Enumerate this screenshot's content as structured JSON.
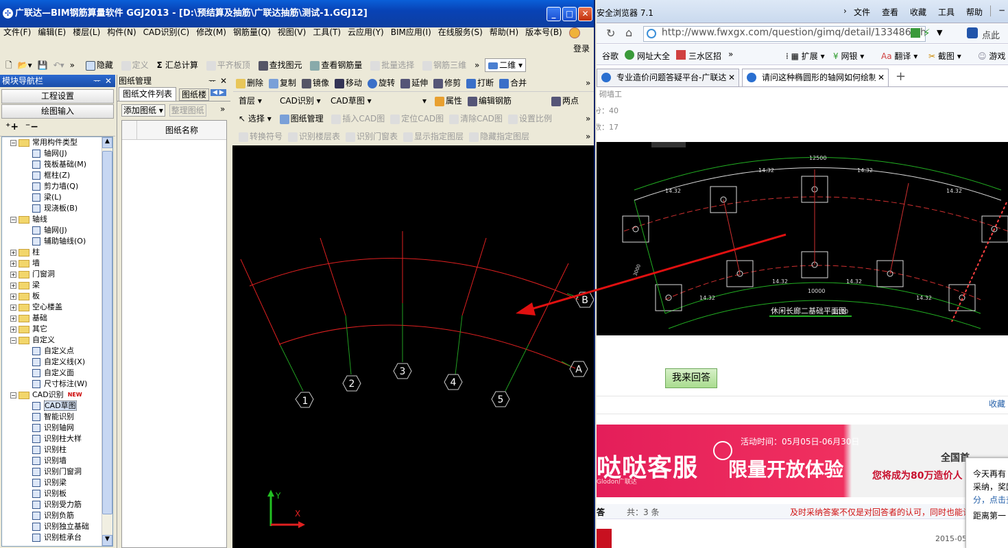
{
  "app": {
    "title": "广联达—BIM钢筋算量软件 GGJ2013 - [D:\\预结算及抽筋\\广联达抽筋\\测试-1.GGJ12]",
    "win_controls": {
      "minimize": "_",
      "maximize": "□",
      "close": "✕"
    },
    "menu": [
      "文件(F)",
      "编辑(E)",
      "楼层(L)",
      "构件(N)",
      "CAD识别(C)",
      "修改(M)",
      "钢筋量(Q)",
      "视图(V)",
      "工具(T)",
      "云应用(Y)",
      "BIM应用(I)",
      "在线服务(S)",
      "帮助(H)",
      "版本号(B)"
    ],
    "login": "登录",
    "toolbar1": {
      "hide": "隐藏",
      "define": "定义",
      "sum": "汇总计算",
      "flat": "平齐板顶",
      "find": "查找图元",
      "view_rebar": "查看钢筋量",
      "batch": "批量选择",
      "rebar3d": "钢筋三维",
      "view_mode": "二维",
      "more": "»"
    },
    "module_nav": {
      "title": "模块导航栏",
      "pin": "ᅲ",
      "close": "✕",
      "btn_settings": "工程设置",
      "btn_input": "绘图输入",
      "tree": [
        {
          "label": "常用构件类型",
          "level": 0,
          "exp": "−",
          "type": "folder"
        },
        {
          "label": "轴网(J)",
          "level": 1,
          "type": "item"
        },
        {
          "label": "筏板基础(M)",
          "level": 1,
          "type": "item"
        },
        {
          "label": "框柱(Z)",
          "level": 1,
          "type": "item"
        },
        {
          "label": "剪力墙(Q)",
          "level": 1,
          "type": "item"
        },
        {
          "label": "梁(L)",
          "level": 1,
          "type": "item"
        },
        {
          "label": "现浇板(B)",
          "level": 1,
          "type": "item"
        },
        {
          "label": "轴线",
          "level": 0,
          "exp": "−",
          "type": "folder"
        },
        {
          "label": "轴网(J)",
          "level": 1,
          "type": "item"
        },
        {
          "label": "辅助轴线(O)",
          "level": 1,
          "type": "item"
        },
        {
          "label": "柱",
          "level": 0,
          "exp": "+",
          "type": "folder"
        },
        {
          "label": "墙",
          "level": 0,
          "exp": "+",
          "type": "folder"
        },
        {
          "label": "门窗洞",
          "level": 0,
          "exp": "+",
          "type": "folder"
        },
        {
          "label": "梁",
          "level": 0,
          "exp": "+",
          "type": "folder"
        },
        {
          "label": "板",
          "level": 0,
          "exp": "+",
          "type": "folder"
        },
        {
          "label": "空心楼盖",
          "level": 0,
          "exp": "+",
          "type": "folder"
        },
        {
          "label": "基础",
          "level": 0,
          "exp": "+",
          "type": "folder"
        },
        {
          "label": "其它",
          "level": 0,
          "exp": "+",
          "type": "folder"
        },
        {
          "label": "自定义",
          "level": 0,
          "exp": "−",
          "type": "folder"
        },
        {
          "label": "自定义点",
          "level": 1,
          "type": "item"
        },
        {
          "label": "自定义线(X)",
          "level": 1,
          "type": "item"
        },
        {
          "label": "自定义面",
          "level": 1,
          "type": "item"
        },
        {
          "label": "尺寸标注(W)",
          "level": 1,
          "type": "item"
        },
        {
          "label": "CAD识别",
          "level": 0,
          "exp": "−",
          "type": "folder",
          "badge": "NEW"
        },
        {
          "label": "CAD草图",
          "level": 1,
          "type": "item",
          "selected": true
        },
        {
          "label": "智能识别",
          "level": 1,
          "type": "item"
        },
        {
          "label": "识别轴网",
          "level": 1,
          "type": "item"
        },
        {
          "label": "识别柱大样",
          "level": 1,
          "type": "item"
        },
        {
          "label": "识别柱",
          "level": 1,
          "type": "item"
        },
        {
          "label": "识别墙",
          "level": 1,
          "type": "item"
        },
        {
          "label": "识别门窗洞",
          "level": 1,
          "type": "item"
        },
        {
          "label": "识别梁",
          "level": 1,
          "type": "item"
        },
        {
          "label": "识别板",
          "level": 1,
          "type": "item"
        },
        {
          "label": "识别受力筋",
          "level": 1,
          "type": "item"
        },
        {
          "label": "识别负筋",
          "level": 1,
          "type": "item"
        },
        {
          "label": "识别独立基础",
          "level": 1,
          "type": "item"
        },
        {
          "label": "识别桩承台",
          "level": 1,
          "type": "item"
        }
      ]
    },
    "drawing_mgmt": {
      "title": "图纸管理",
      "tab1": "图纸文件列表",
      "tab2": "图纸楼",
      "add": "添加图纸",
      "organize": "整理图纸",
      "col_name": "图纸名称"
    },
    "edit_toolbar": {
      "delete": "删除",
      "copy": "复制",
      "mirror": "镜像",
      "move": "移动",
      "rotate": "旋转",
      "extend": "延伸",
      "trim": "修剪",
      "break": "打断",
      "merge": "合并"
    },
    "selectors": {
      "floor": "首层",
      "cad": "CAD识别",
      "sketch": "CAD草图",
      "empty": "",
      "props": "属性",
      "edit_rebar": "编辑钢筋",
      "two_point": "两点"
    },
    "cad_toolbar": {
      "select": "选择",
      "drawing_mgmt": "图纸管理",
      "insert": "插入CAD图",
      "locate": "定位CAD图",
      "clear": "清除CAD图",
      "set_scale": "设置比例"
    },
    "cad_toolbar2": {
      "convert": "转换符号",
      "floor_table": "识别楼层表",
      "door_table": "识别门窗表",
      "show_layer": "显示指定图层",
      "hide_layer": "隐藏指定图层"
    },
    "canvas": {
      "axis_labels": [
        "1",
        "2",
        "3",
        "4",
        "5"
      ],
      "row_labels": [
        "A",
        "B"
      ],
      "coord_x": "X",
      "coord_y": "Y"
    }
  },
  "browser": {
    "title": "安全浏览器 7.1",
    "menu": [
      "文件",
      "查看",
      "收藏",
      "工具",
      "帮助"
    ],
    "url": "http://www.fwxgx.com/question/gimq/detail/1334865.htm",
    "bookmarks": [
      "谷歌",
      "网址大全",
      "三水区招"
    ],
    "bm_more": "»",
    "bm_right": [
      "扩展",
      "网银",
      "翻译",
      "截图",
      "游戏"
    ],
    "tabs": [
      {
        "title": "专业造价问题答疑平台-广联达",
        "active": false
      },
      {
        "title": "请问这种椭圆形的轴网如何绘制",
        "active": true
      }
    ],
    "new_tab": "+",
    "search_hint": "点此",
    "page": {
      "meta1": "砌墙工",
      "meta2": "分：40",
      "meta3": "数：17",
      "cad_plan_title": "休闲长廊二基础平面图",
      "cad_plan_scale": "1:100",
      "dims": [
        "12500",
        "14.32",
        "10000",
        "3000"
      ],
      "answer_btn": "我来回答",
      "collect": "收藏",
      "banner_time": "活动时间：05月05日-06月30日",
      "banner_big": "哒哒客服",
      "banner_big2": "限量开放体验",
      "banner_sub": "您将成为80万造价人",
      "banner_right": "全国首",
      "banner_brand": "Glodon广联达",
      "answers_label": "答",
      "answers_count": "共：3 条",
      "notice": "及时采纳答案不仅是对回答者的认可，同时也能让",
      "popup": [
        "今天再有",
        "采纳，奖励",
        "分，点击查",
        "距离第一"
      ],
      "date": "2015-05"
    }
  }
}
